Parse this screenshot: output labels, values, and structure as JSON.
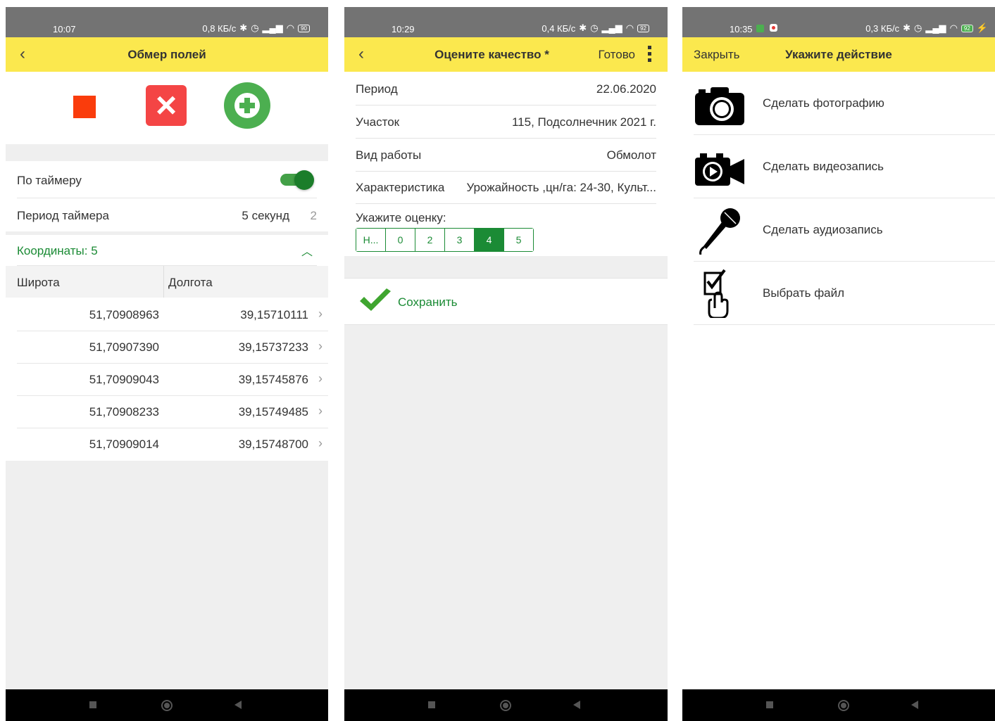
{
  "screen1": {
    "status": {
      "time": "10:07",
      "net": "0,8 КБ/с",
      "battery": "90"
    },
    "title": "Обмер полей",
    "timer_label": "По таймеру",
    "timer_on": true,
    "period_label": "Период таймера",
    "period_value": "5 секунд",
    "period_num": "2",
    "coords_header": "Координаты: 5",
    "col_lat": "Широта",
    "col_lon": "Долгота",
    "coords": [
      {
        "lat": "51,70908963",
        "lon": "39,15710111"
      },
      {
        "lat": "51,70907390",
        "lon": "39,15737233"
      },
      {
        "lat": "51,70909043",
        "lon": "39,15745876"
      },
      {
        "lat": "51,70908233",
        "lon": "39,15749485"
      },
      {
        "lat": "51,70909014",
        "lon": "39,15748700"
      }
    ]
  },
  "screen2": {
    "status": {
      "time": "10:29",
      "net": "0,4 КБ/с",
      "battery": "92"
    },
    "title": "Оцените качество *",
    "done": "Готово",
    "fields": [
      {
        "label": "Период",
        "value": "22.06.2020"
      },
      {
        "label": "Участок",
        "value": "115, Подсолнечник 2021 г."
      },
      {
        "label": "Вид работы",
        "value": "Обмолот"
      },
      {
        "label": "Характеристика",
        "value": "Урожайность ,цн/га: 24-30, Культ..."
      }
    ],
    "rating_label": "Укажите оценку:",
    "rating_options": [
      "Н...",
      "0",
      "2",
      "3",
      "4",
      "5"
    ],
    "rating_selected": "4",
    "save": "Сохранить"
  },
  "screen3": {
    "status": {
      "time": "10:35",
      "net": "0,3 КБ/с",
      "battery": "92"
    },
    "close": "Закрыть",
    "title": "Укажите действие",
    "actions": [
      {
        "label": "Сделать фотографию",
        "icon": "camera-icon"
      },
      {
        "label": "Сделать видеозапись",
        "icon": "video-camera-icon"
      },
      {
        "label": "Сделать аудиозапись",
        "icon": "microphone-icon"
      },
      {
        "label": "Выбрать файл",
        "icon": "select-file-icon"
      }
    ]
  },
  "colors": {
    "appbar": "#fbe84e",
    "green": "#1b8b35",
    "status": "#737373"
  }
}
